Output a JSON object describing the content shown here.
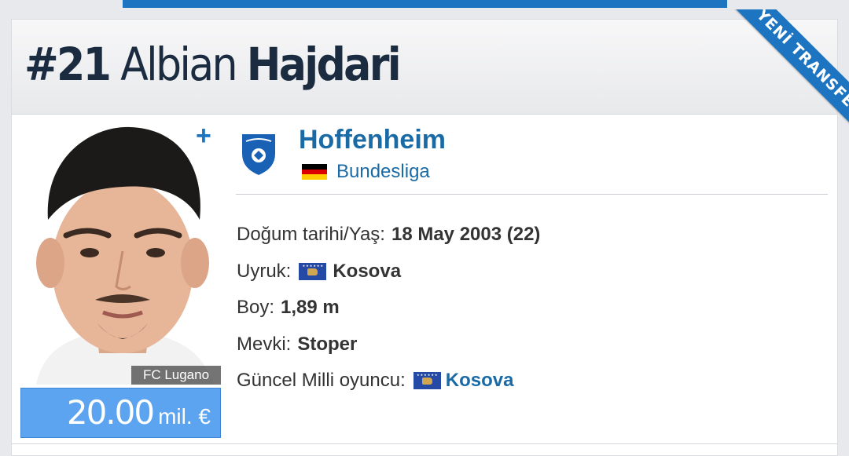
{
  "header": {
    "number": "#21",
    "first_name": "Albian",
    "last_name": "Hajdari"
  },
  "ribbon": {
    "label": "YENİ TRANSFER",
    "color": "#1d75c2"
  },
  "photo": {
    "club_caption": "FC Lugano"
  },
  "market_value": {
    "amount": "20.00",
    "unit": "mil. €"
  },
  "club": {
    "name": "Hoffenheim",
    "logo_icon": "hoffenheim-crest-icon",
    "league": "Bundesliga",
    "league_flag_icon": "germany-flag-icon"
  },
  "info": {
    "birth_label": "Doğum tarihi/Yaş:",
    "birth_value": "18 May 2003 (22)",
    "nationality_label": "Uyruk:",
    "nationality_value": "Kosova",
    "height_label": "Boy:",
    "height_value": "1,89 m",
    "position_label": "Mevki:",
    "position_value": "Stoper",
    "national_team_label": "Güncel Milli oyuncu:",
    "national_team_value": "Kosova"
  },
  "colors": {
    "accent": "#1d75c2",
    "link": "#1a6aa6",
    "value_box": "#5ca3f0",
    "title": "#1b2b40"
  }
}
